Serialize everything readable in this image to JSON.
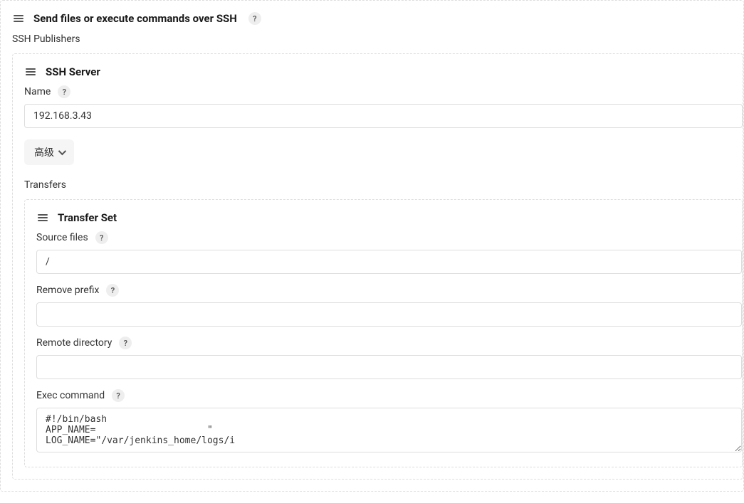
{
  "main": {
    "title": "Send files or execute commands over SSH",
    "publishers_label": "SSH Publishers",
    "ssh_server": {
      "title": "SSH Server",
      "name_label": "Name",
      "name_value": "192.168.3.43",
      "advanced_label": "高级",
      "transfers_label": "Transfers",
      "transfer_set": {
        "title": "Transfer Set",
        "source_files_label": "Source files",
        "source_files_value": "/",
        "remove_prefix_label": "Remove prefix",
        "remove_prefix_value": "",
        "remote_directory_label": "Remote directory",
        "remote_directory_value": "",
        "exec_command_label": "Exec command",
        "exec_command_value": "#!/bin/bash\nAPP_NAME=                    \"\nLOG_NAME=\"/var/jenkins_home/logs/i"
      }
    }
  }
}
